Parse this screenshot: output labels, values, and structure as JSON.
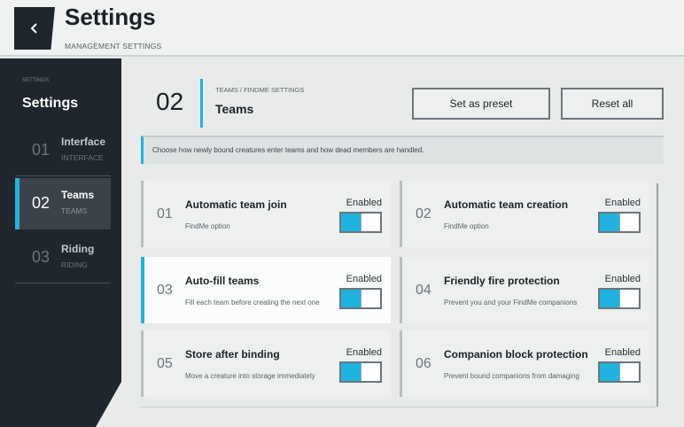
{
  "header": {
    "title": "Settings",
    "subtitle": "MANAGEMENT SETTINGS"
  },
  "sidebar": {
    "small_label": "SETTINGS",
    "title": "Settings",
    "items": [
      {
        "num": "01",
        "label": "Interface",
        "sub": "INTERFACE"
      },
      {
        "num": "02",
        "label": "Teams",
        "sub": "TEAMS"
      },
      {
        "num": "03",
        "label": "Riding",
        "sub": "RIDING"
      }
    ],
    "active_index": 1
  },
  "section": {
    "num": "02",
    "breadcrumb": "TEAMS / FINDME SETTINGS",
    "title": "Teams",
    "preset_label": "Set as preset",
    "reset_label": "Reset all",
    "description": "Choose how newly bound creatures enter teams and how dead members are handled."
  },
  "options": [
    {
      "num": "01",
      "title": "Automatic team join",
      "desc": "FindMe option",
      "state": "Enabled",
      "on": true
    },
    {
      "num": "02",
      "title": "Automatic team creation",
      "desc": "FindMe option",
      "state": "Enabled",
      "on": true
    },
    {
      "num": "03",
      "title": "Auto-fill teams",
      "desc": "Fill each team before creating the next one",
      "state": "Enabled",
      "on": true
    },
    {
      "num": "04",
      "title": "Friendly fire protection",
      "desc": "Prevent you and your FindMe companions",
      "state": "Enabled",
      "on": true
    },
    {
      "num": "05",
      "title": "Store after binding",
      "desc": "Move a creature into storage immediately",
      "state": "Enabled",
      "on": true
    },
    {
      "num": "06",
      "title": "Companion block protection",
      "desc": "Prevent bound companions from damaging",
      "state": "Enabled",
      "on": true
    }
  ],
  "colors": {
    "accent": "#1fb4e0",
    "sidebar_bg": "#1f262d",
    "page_bg": "#e9ebeb"
  },
  "icons": {
    "back": "chevron-left-icon"
  }
}
